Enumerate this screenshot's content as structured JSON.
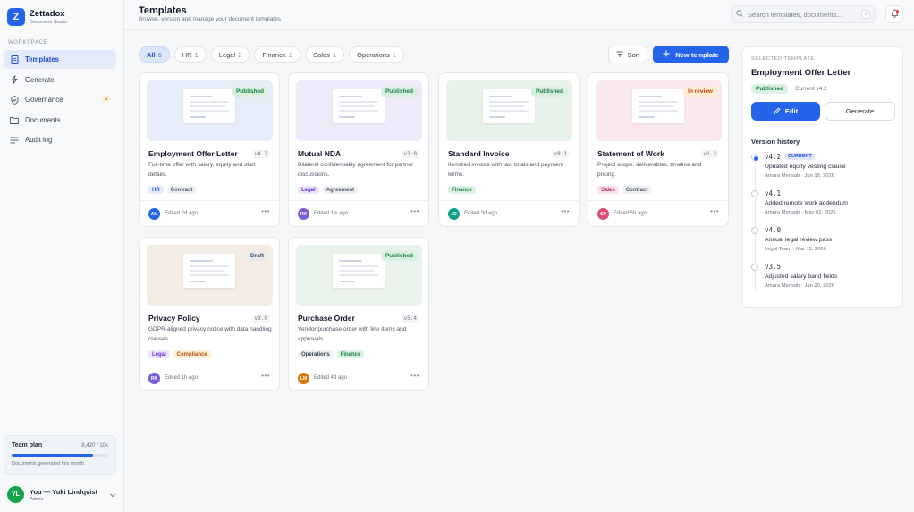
{
  "app": {
    "name": "Zettadox",
    "subtitle": "Document Studio",
    "logo_letter": "Z"
  },
  "sidebar": {
    "section_label": "WORKSPACE",
    "items": [
      {
        "label": "Templates",
        "icon": "file-icon",
        "active": true
      },
      {
        "label": "Generate",
        "icon": "bolt-icon"
      },
      {
        "label": "Governance",
        "icon": "shield-icon",
        "badge": "3"
      },
      {
        "label": "Documents",
        "icon": "folder-icon"
      },
      {
        "label": "Audit log",
        "icon": "list-icon"
      }
    ],
    "plan": {
      "title": "Team plan",
      "count": "8,420 / 10k",
      "progress": 0.842,
      "subtitle": "Documents generated this month"
    },
    "user": {
      "initials": "YL",
      "name": "You — Yuki Lindqvist",
      "role": "Admin"
    }
  },
  "header": {
    "title": "Templates",
    "subtitle": "Browse, version and manage your document templates",
    "search_placeholder": "Search templates, documents...",
    "search_shortcut": "/"
  },
  "filters": [
    {
      "label": "All",
      "count": "6",
      "active": true
    },
    {
      "label": "HR",
      "count": "1"
    },
    {
      "label": "Legal",
      "count": "2"
    },
    {
      "label": "Finance",
      "count": "2"
    },
    {
      "label": "Sales",
      "count": "1"
    },
    {
      "label": "Operations",
      "count": "1"
    }
  ],
  "toolbar": {
    "sort_label": "Sort",
    "new_label": "New template"
  },
  "templates": [
    {
      "title": "Employment Offer Letter",
      "version": "v4.2",
      "status": "Published",
      "description": "Full-time offer with salary, equity and start details.",
      "tags": [
        "HR",
        "Contract"
      ],
      "initials": "AM",
      "edited": "Edited 2d ago",
      "thumb_color": "#e7edf8",
      "avatar_color": "#2563eb"
    },
    {
      "title": "Mutual NDA",
      "version": "v2.0",
      "status": "Published",
      "description": "Bilateral confidentiality agreement for partner discussions.",
      "tags": [
        "Legal",
        "Agreement"
      ],
      "initials": "RK",
      "edited": "Edited 1w ago",
      "thumb_color": "#efeaf9",
      "avatar_color": "#7c5cd6"
    },
    {
      "title": "Standard Invoice",
      "version": "v8.1",
      "status": "Published",
      "description": "Itemized invoice with tax, totals and payment terms.",
      "tags": [
        "Finance"
      ],
      "initials": "JD",
      "edited": "Edited 3d ago",
      "thumb_color": "#e6f2ea",
      "avatar_color": "#0f9f8a"
    },
    {
      "title": "Statement of Work",
      "version": "v1.3",
      "status": "In review",
      "description": "Project scope, deliverables, timeline and pricing.",
      "tags": [
        "Sales",
        "Contract"
      ],
      "initials": "SP",
      "edited": "Edited 5h ago",
      "thumb_color": "#f9e8ed",
      "avatar_color": "#db4b74"
    },
    {
      "title": "Privacy Policy",
      "version": "v3.0",
      "status": "Draft",
      "description": "GDPR-aligned privacy notice with data handling clauses.",
      "tags": [
        "Legal",
        "Compliance"
      ],
      "initials": "RK",
      "edited": "Edited 1h ago",
      "thumb_color": "#f3ece4",
      "avatar_color": "#7c5cd6"
    },
    {
      "title": "Purchase Order",
      "version": "v5.4",
      "status": "Published",
      "description": "Vendor purchase order with line items and approvals.",
      "tags": [
        "Operations",
        "Finance"
      ],
      "initials": "LM",
      "edited": "Edited 4d ago",
      "thumb_color": "#eaf2ec",
      "avatar_color": "#d97706"
    }
  ],
  "panel": {
    "label": "SELECTED TEMPLATE",
    "title": "Employment Offer Letter",
    "status": "Published",
    "current": "Current v4.2",
    "edit_label": "Edit",
    "generate_label": "Generate",
    "history_title": "Version history",
    "history": [
      {
        "version": "v4.2",
        "badge": "CURRENT",
        "description": "Updated equity vesting clause",
        "meta": "Amara Mensah · Jun 18, 2026"
      },
      {
        "version": "v4.1",
        "description": "Added remote work addendum",
        "meta": "Amara Mensah · May 02, 2026"
      },
      {
        "version": "v4.0",
        "description": "Annual legal review pass",
        "meta": "Legal Team · Mar 11, 2026"
      },
      {
        "version": "v3.5",
        "description": "Adjusted salary band fields",
        "meta": "Amara Mensah · Jan 20, 2026"
      }
    ]
  }
}
